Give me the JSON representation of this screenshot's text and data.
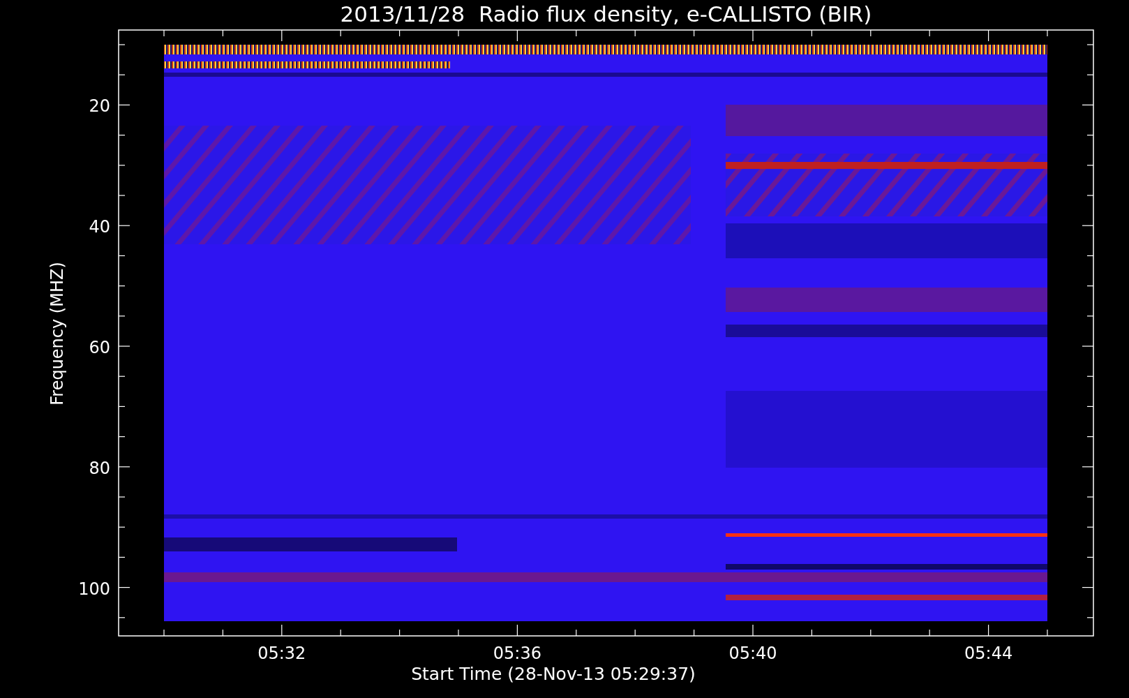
{
  "title": "2013/11/28  Radio flux density, e-CALLISTO (BIR)",
  "y_axis": {
    "label": "Frequency (MHZ)",
    "ticks": [
      "20",
      "40",
      "60",
      "80",
      "100"
    ]
  },
  "x_axis": {
    "label": "Start Time (28-Nov-13 05:29:37)",
    "ticks": [
      "05:32",
      "05:36",
      "05:40",
      "05:44"
    ]
  }
}
